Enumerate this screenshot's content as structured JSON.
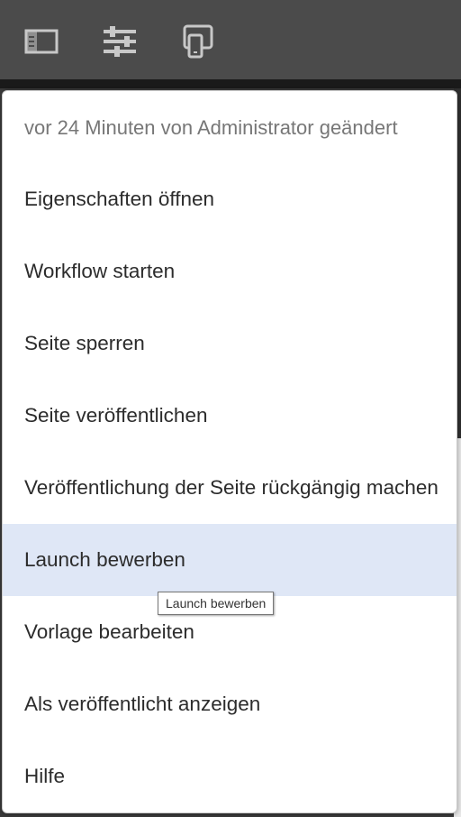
{
  "toolbar": {
    "icons": [
      "sidebar-icon",
      "sliders-icon",
      "device-preview-icon"
    ],
    "icon_color": "#c8c8c8"
  },
  "menu": {
    "meta_text": "vor 24 Minuten von Administrator geändert",
    "items": [
      {
        "label": "Eigenschaften öffnen"
      },
      {
        "label": "Workflow starten"
      },
      {
        "label": "Seite sperren"
      },
      {
        "label": "Seite veröffentlichen"
      },
      {
        "label": "Veröffentlichung der Seite rückgängig machen"
      },
      {
        "label": "Launch bewerben",
        "highlighted": true
      },
      {
        "label": "Vorlage bearbeiten"
      },
      {
        "label": "Als veröffentlicht anzeigen"
      },
      {
        "label": "Hilfe"
      }
    ],
    "highlight_color": "#dfe7f6"
  },
  "tooltip": {
    "text": "Launch bewerben"
  }
}
